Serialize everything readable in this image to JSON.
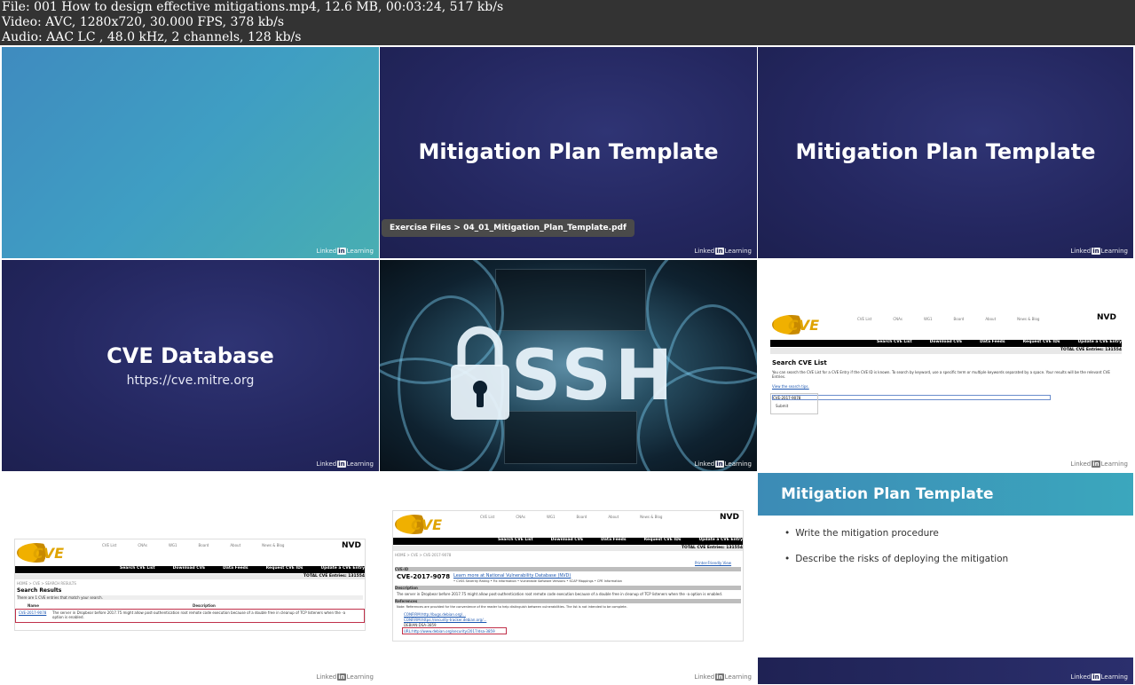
{
  "header": {
    "file_line": "File: 001 How to design effective mitigations.mp4, 12.6 MB, 00:03:24, 517 kb/s",
    "video_line": "Video: AVC, 1280x720, 30.000 FPS, 378 kb/s",
    "audio_line": "Audio: AAC LC , 48.0 kHz, 2 channels, 128 kb/s"
  },
  "branding": {
    "linkedin_left": "Linked",
    "linkedin_in": "in",
    "linkedin_right": "Learning"
  },
  "frames": {
    "f2": {
      "title": "Mitigation Plan Template",
      "path": "Exercise Files > 04_01_Mitigation_Plan_Template.pdf"
    },
    "f3": {
      "title": "Mitigation Plan Template"
    },
    "f4": {
      "title": "CVE Database",
      "subtitle": "https://cve.mitre.org"
    },
    "f5": {
      "text": "SSH"
    },
    "f6": {
      "logo": "CVE",
      "nav": [
        "CVE List",
        "CNAs",
        "WG1",
        "Board",
        "About",
        "News & Blog"
      ],
      "nvd": "NVD",
      "bar": [
        "Search CVE List",
        "Download CVE",
        "Data Feeds",
        "Request CVE IDs",
        "Update a CVE Entry"
      ],
      "total": "TOTAL CVE Entries: 131554",
      "heading": "Search CVE List",
      "desc": "You can search the CVE List for a CVE Entry if the CVE ID is known. To search by keyword, use a specific term or multiple keywords separated by a space. Your results will be the relevant CVE Entries.",
      "view": "View the search tips.",
      "input_value": "CVE-2017-9078",
      "submit": "Submit"
    },
    "f7": {
      "logo": "CVE",
      "nav": [
        "CVE List",
        "CNAs",
        "WG1",
        "Board",
        "About",
        "News & Blog"
      ],
      "nvd": "NVD",
      "bar": [
        "Search CVE List",
        "Download CVE",
        "Data Feeds",
        "Request CVE IDs",
        "Update a CVE Entry"
      ],
      "total": "TOTAL CVE Entries: 131554",
      "crumb": "HOME > CVE > SEARCH RESULTS",
      "heading": "Search Results",
      "count": "There are 1 CVE entries that match your search.",
      "col_name": "Name",
      "col_desc": "Description",
      "row_id": "CVE-2017-9078",
      "row_desc": "The server in Dropbear before 2017.75 might allow post-authentication root remote code execution because of a double free in cleanup of TCP listeners when the -a option is enabled."
    },
    "f8": {
      "logo": "CVE",
      "nav": [
        "CVE List",
        "CNAs",
        "WG1",
        "Board",
        "About",
        "News & Blog"
      ],
      "nvd": "NVD",
      "bar": [
        "Search CVE List",
        "Download CVE",
        "Data Feeds",
        "Request CVE IDs",
        "Update a CVE Entry"
      ],
      "total": "TOTAL CVE Entries: 131554",
      "crumb": "HOME > CVE > CVE-2017-9078",
      "printer": "Printer-Friendly View",
      "id_label": "CVE-ID",
      "id": "CVE-2017-9078",
      "nvd_link": "Learn more at National Vulnerability Database (NVD)",
      "nvd_sub": "• CVSS Severity Rating • Fix Information • Vulnerable Software Versions • SCAP Mappings • CPE Information",
      "desc_label": "Description",
      "desc": "The server in Dropbear before 2017.75 might allow post-authentication root remote code execution because of a double free in cleanup of TCP listeners when the -a option is enabled.",
      "refs_label": "References",
      "refs_note": "Note: References are provided for the convenience of the reader to help distinguish between vulnerabilities. The list is not intended to be complete.",
      "refs": [
        "CONFIRM:http://bugs.debian.org/...",
        "CONFIRM:https://security-tracker.debian.org/...",
        "DEBIAN:DSA-3859",
        "URL:http://www.debian.org/security/2017/dsa-3859"
      ]
    },
    "f9": {
      "title": "Mitigation Plan Template",
      "bullets": [
        "Write the mitigation procedure",
        "Describe the risks of deploying the mitigation"
      ]
    }
  }
}
